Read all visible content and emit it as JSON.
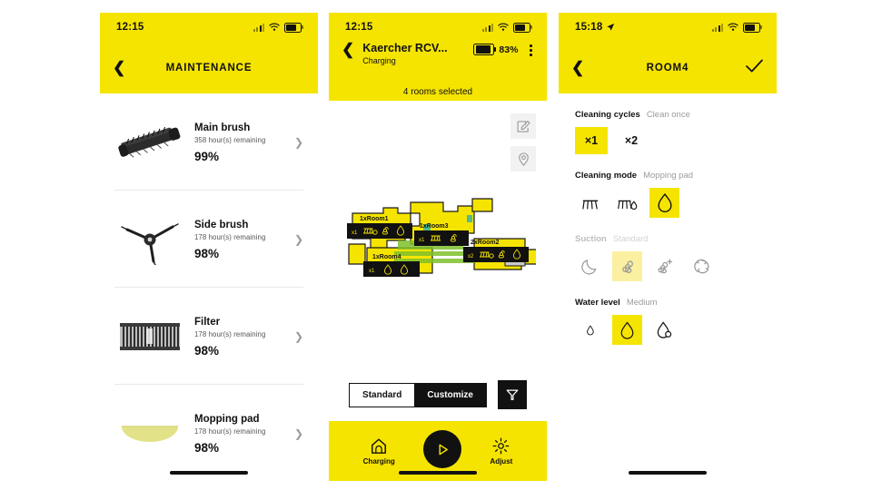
{
  "panels": {
    "maintenance": {
      "status": {
        "time": "12:15",
        "signal_icon": "cellular-bars-icon",
        "wifi_icon": "wifi-icon",
        "battery_icon": "battery-icon"
      },
      "nav": {
        "back_icon": "back-chevron-icon",
        "title": "MAINTENANCE"
      },
      "items": [
        {
          "icon": "main-brush-icon",
          "name": "Main brush",
          "remaining": "358 hour(s) remaining",
          "percent": "99%",
          "chevron": "chevron-right-icon"
        },
        {
          "icon": "side-brush-icon",
          "name": "Side brush",
          "remaining": "178 hour(s) remaining",
          "percent": "98%",
          "chevron": "chevron-right-icon"
        },
        {
          "icon": "filter-icon",
          "name": "Filter",
          "remaining": "178 hour(s) remaining",
          "percent": "98%",
          "chevron": "chevron-right-icon"
        },
        {
          "icon": "mopping-pad-icon",
          "name": "Mopping pad",
          "remaining": "178 hour(s) remaining",
          "percent": "98%",
          "chevron": "chevron-right-icon"
        }
      ]
    },
    "map": {
      "status": {
        "time": "12:15",
        "signal_icon": "cellular-bars-icon",
        "wifi_icon": "wifi-icon",
        "battery_icon": "battery-icon"
      },
      "device": {
        "back_icon": "back-chevron-icon",
        "title": "Kaercher RCV...",
        "state": "Charging",
        "battery_percent": "83%",
        "battery_icon": "battery-icon",
        "menu_icon": "kebab-menu-icon"
      },
      "rooms_selected": "4 rooms selected",
      "tools": [
        {
          "icon": "edit-map-icon",
          "label": "Edit map"
        },
        {
          "icon": "location-pin-icon",
          "label": "Go to point"
        }
      ],
      "rooms": [
        {
          "label": "1xRoom1",
          "cycles": "x1",
          "icons": [
            "mop-pad-icon",
            "fan-icon",
            "water-drop-icon"
          ]
        },
        {
          "label": "1xRoom3",
          "cycles": "x1",
          "icons": [
            "mop-pad-icon",
            "fan-icon"
          ]
        },
        {
          "label": "2xRoom2",
          "cycles": "x2",
          "icons": [
            "mop-pad-icon",
            "fan-icon",
            "water-drop-icon"
          ]
        },
        {
          "label": "1xRoom4",
          "cycles": "x1",
          "icons": [
            "water-drop-icon",
            "water-drop-icon"
          ]
        }
      ],
      "mode_toggle": {
        "standard": "Standard",
        "customize": "Customize",
        "selected": "Customize"
      },
      "filter_button_icon": "funnel-icon",
      "tabbar": {
        "left": {
          "icon": "home-dock-icon",
          "label": "Charging"
        },
        "center": {
          "icon": "play-icon",
          "label": "Start"
        },
        "right": {
          "icon": "gear-icon",
          "label": "Adjust"
        }
      }
    },
    "room": {
      "status": {
        "time": "15:18",
        "location_icon": "location-arrow-icon",
        "signal_icon": "cellular-bars-icon",
        "wifi_icon": "wifi-icon",
        "battery_icon": "battery-icon"
      },
      "nav": {
        "back_icon": "back-chevron-icon",
        "title": "ROOM4",
        "confirm_icon": "checkmark-icon"
      },
      "sections": [
        {
          "title": "Cleaning cycles",
          "value": "Clean once",
          "disabled": false,
          "options": [
            {
              "text": "×1",
              "selected": true
            },
            {
              "text": "×2",
              "selected": false
            }
          ]
        },
        {
          "title": "Cleaning mode",
          "value": "Mopping pad",
          "disabled": false,
          "options": [
            {
              "icon": "vacuum-icon",
              "selected": false
            },
            {
              "icon": "vacuum-mop-icon",
              "selected": false
            },
            {
              "icon": "mop-drop-icon",
              "selected": true
            }
          ]
        },
        {
          "title": "Suction",
          "value": "Standard",
          "disabled": true,
          "options": [
            {
              "icon": "moon-quiet-icon",
              "selected": false
            },
            {
              "icon": "fan-standard-icon",
              "selected": true
            },
            {
              "icon": "fan-plus-icon",
              "selected": false
            },
            {
              "icon": "turbo-cyclone-icon",
              "selected": false
            }
          ]
        },
        {
          "title": "Water level",
          "value": "Medium",
          "disabled": false,
          "options": [
            {
              "icon": "drop-small-icon",
              "selected": false
            },
            {
              "icon": "drop-medium-icon",
              "selected": true
            },
            {
              "icon": "drop-large-icon",
              "selected": false
            }
          ]
        }
      ]
    }
  },
  "colors": {
    "brand_yellow": "#F5E400",
    "soft_yellow": "#FAF0A0",
    "ink": "#111111",
    "muted": "#9B9B9B"
  }
}
